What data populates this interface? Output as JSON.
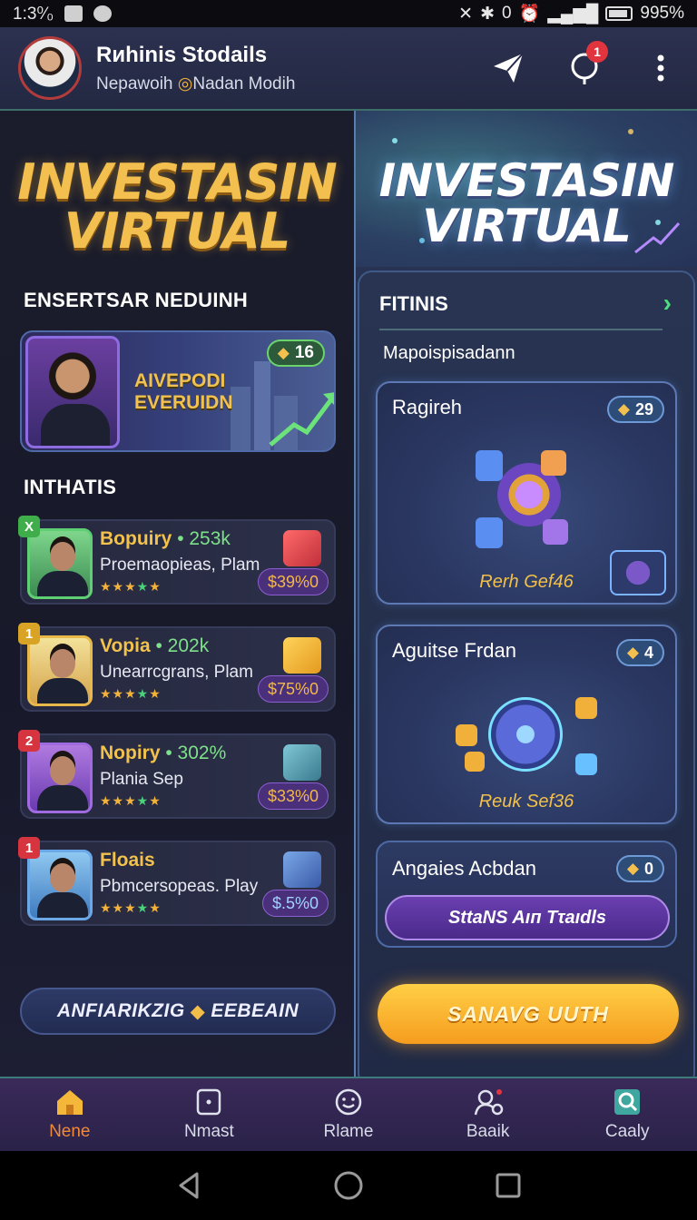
{
  "status_bar": {
    "time": "1:3⁰⁄₀",
    "battery": "995%"
  },
  "header": {
    "user_name": "Rиhinis Stodails",
    "user_subtitle_left": "Nepawoih",
    "user_subtitle_right": "Nadan Modih",
    "notification_count": "1"
  },
  "left": {
    "title_line1": "INVESTASIN",
    "title_line2": "VIRTUAL",
    "section1": "ENSERTSAR NEDUINH",
    "feature": {
      "line1": "AIVEPODI",
      "line2": "EVERUIDN",
      "badge": "16"
    },
    "section2": "INTHATIS",
    "investors": [
      {
        "rank": "X",
        "name": "Bopuiry",
        "growth": "• 253k",
        "sub": "Proemaopieas, Plam",
        "price": "$39%0"
      },
      {
        "rank": "1",
        "name": "Vopiа",
        "growth": "• 202k",
        "sub": "Unearrcgrans, Plam",
        "price": "$75%0"
      },
      {
        "rank": "2",
        "name": "Nopiry",
        "growth": "• 302%",
        "sub": "Plania Sep",
        "price": "$33%0"
      },
      {
        "rank": "1",
        "name": "Floais",
        "growth": "",
        "sub": "Pbmcersopeas. Play",
        "price": "$.5%0"
      }
    ],
    "bottom_pill_left": "ANFIARIKZIG",
    "bottom_pill_right": "EEBEAIN"
  },
  "right": {
    "title_line1": "INVESTASIN",
    "title_line2": "VIRTUAL",
    "list_header": "FITINIS",
    "list_subheader": "Mapoispisadann",
    "cards": [
      {
        "title": "Ragireh",
        "badge": "29",
        "caption": "Rerh Gef46"
      },
      {
        "title": "Aguitse Frdan",
        "badge": "4",
        "caption": "Reuk Sef36"
      }
    ],
    "action_card": {
      "title": "Angaies Acbdan",
      "badge": "0",
      "button": "SttaNS Aıп Tτaıdls"
    },
    "cta": "SANAVG UUTH"
  },
  "bottom_nav": [
    {
      "label": "Nene",
      "icon": "home-icon"
    },
    {
      "label": "Nmast",
      "icon": "square-dot-icon"
    },
    {
      "label": "Rlame",
      "icon": "smile-icon"
    },
    {
      "label": "Baaik",
      "icon": "people-icon"
    },
    {
      "label": "Caaly",
      "icon": "search-icon"
    }
  ],
  "colors": {
    "gold": "#f3c04f",
    "accent_green": "#4be07d",
    "cta_orange": "#f59c1e",
    "active_nav": "#f08a3a"
  }
}
